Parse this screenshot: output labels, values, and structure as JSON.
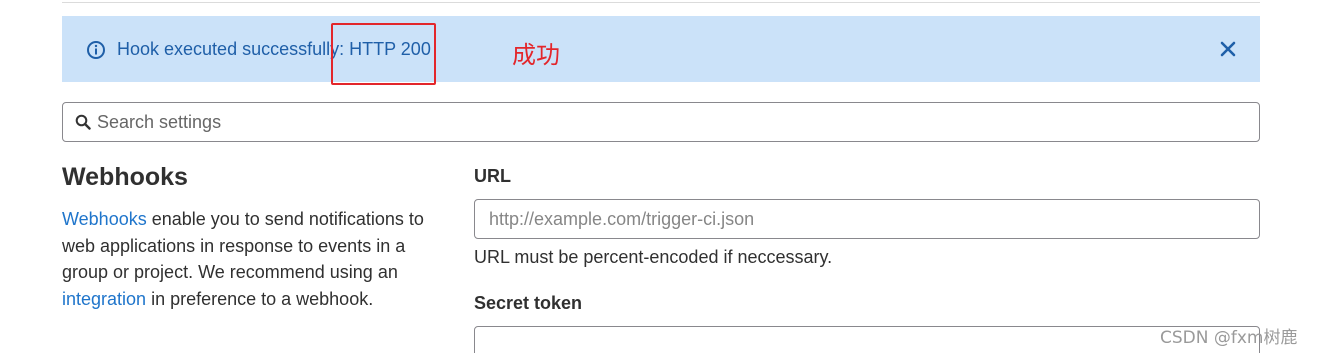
{
  "alert": {
    "message": "Hook executed successfully: ",
    "status": "HTTP 200",
    "icon": "info-icon",
    "close_icon": "close-icon"
  },
  "annotation": {
    "text": "成功",
    "color": "#e3262b"
  },
  "search": {
    "placeholder": "Search settings",
    "value": ""
  },
  "webhooks": {
    "title": "Webhooks",
    "desc_link1": "Webhooks",
    "desc_text1": " enable you to send notifications to web applications in response to events in a group or project. We recommend using an ",
    "desc_link2": "integration",
    "desc_text2": " in preference to a webhook."
  },
  "form": {
    "url_label": "URL",
    "url_placeholder": "http://example.com/trigger-ci.json",
    "url_value": "",
    "url_help": "URL must be percent-encoded if neccessary.",
    "token_label": "Secret token",
    "token_value": ""
  },
  "watermark": "CSDN @fxm树鹿",
  "colors": {
    "alert_bg": "#cbe2f9",
    "alert_text": "#1f5fa8",
    "link": "#1f75cb"
  }
}
